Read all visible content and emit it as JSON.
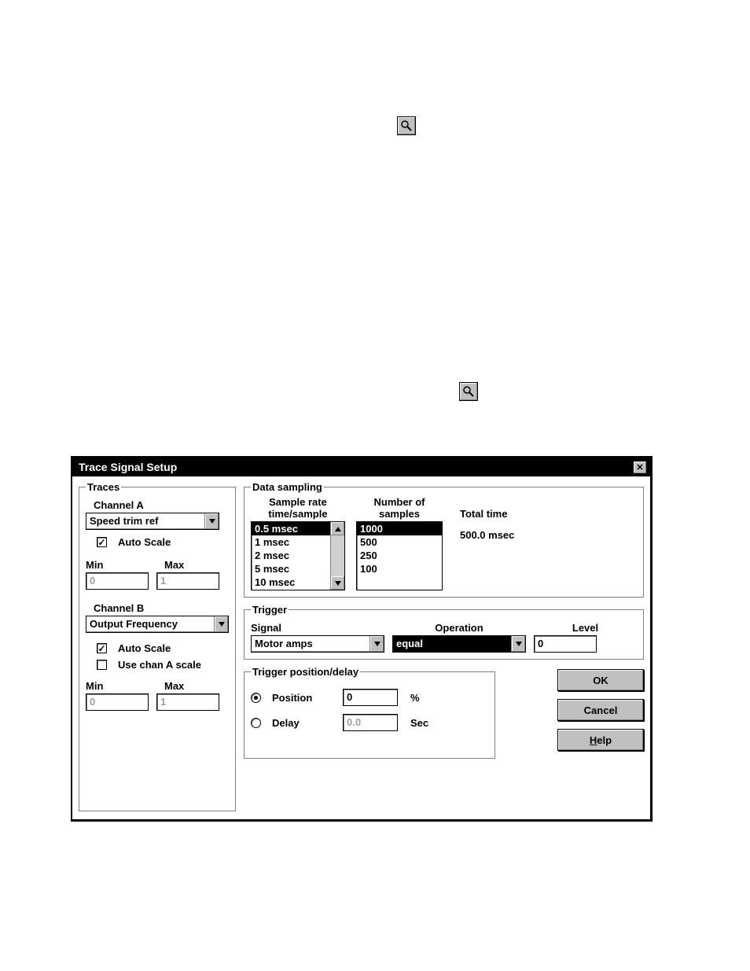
{
  "toolbar_buttons": {
    "magnify1": "magnifier-icon",
    "magnify2": "magnifier-icon"
  },
  "dialog": {
    "title": "Trace Signal Setup",
    "close_label": "✕",
    "buttons": {
      "ok": "OK",
      "cancel": "Cancel",
      "help_prefix": "H",
      "help_rest": "elp"
    }
  },
  "traces": {
    "legend": "Traces",
    "channel_a_label": "Channel A",
    "channel_a_value": "Speed trim ref",
    "auto_scale_a_label": "Auto Scale",
    "auto_scale_a_checked": true,
    "min_label": "Min",
    "max_label": "Max",
    "min_a": "0",
    "max_a": "1",
    "channel_b_label": "Channel B",
    "channel_b_value": "Output Frequency",
    "auto_scale_b_label": "Auto Scale",
    "auto_scale_b_checked": true,
    "use_chan_a_label": "Use chan A scale",
    "use_chan_a_checked": false,
    "min_b": "0",
    "max_b": "1"
  },
  "data_sampling": {
    "legend": "Data sampling",
    "sample_rate_hdr_line1": "Sample rate",
    "sample_rate_hdr_line2": "time/sample",
    "num_samples_hdr_line1": "Number of",
    "num_samples_hdr_line2": "samples",
    "total_time_hdr": "Total time",
    "total_time_value": "500.0 msec",
    "sample_rate_options": [
      "0.5 msec",
      "1 msec",
      "2 msec",
      "5 msec",
      "10 msec"
    ],
    "sample_rate_selected_index": 0,
    "num_samples_options": [
      "1000",
      "500",
      "250",
      "100"
    ],
    "num_samples_selected_index": 0
  },
  "trigger": {
    "legend": "Trigger",
    "signal_label": "Signal",
    "operation_label": "Operation",
    "level_label": "Level",
    "signal_value": "Motor amps",
    "operation_value": "equal",
    "level_value": "0"
  },
  "trigger_posdelay": {
    "legend": "Trigger position/delay",
    "position_label": "Position",
    "position_checked": true,
    "position_value": "0",
    "position_unit": "%",
    "delay_label": "Delay",
    "delay_checked": false,
    "delay_value": "0.0",
    "delay_unit": "Sec"
  }
}
